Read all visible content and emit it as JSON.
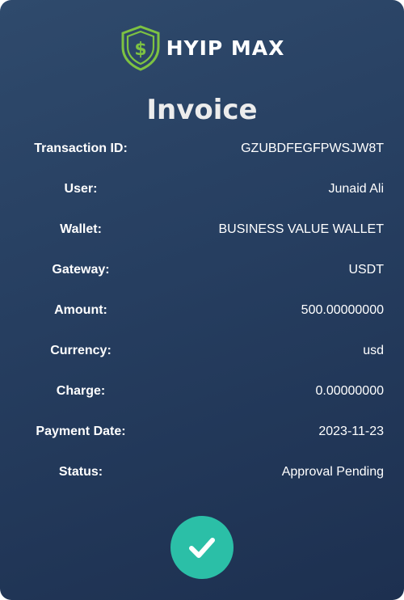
{
  "brand": {
    "name": "HYIP MAX",
    "icon": "shield-dollar-icon",
    "accent_color": "#7dc242"
  },
  "title": "Invoice",
  "invoice": [
    {
      "label": "Transaction ID:",
      "value": "GZUBDFEGFPWSJW8T"
    },
    {
      "label": "User:",
      "value": "Junaid Ali"
    },
    {
      "label": "Wallet:",
      "value": "BUSINESS VALUE WALLET"
    },
    {
      "label": "Gateway:",
      "value": "USDT"
    },
    {
      "label": "Amount:",
      "value": "500.00000000"
    },
    {
      "label": "Currency:",
      "value": "usd"
    },
    {
      "label": "Charge:",
      "value": "0.00000000"
    },
    {
      "label": "Payment Date:",
      "value": "2023-11-23"
    },
    {
      "label": "Status:",
      "value": "Approval Pending"
    }
  ],
  "confirm_button": {
    "icon": "checkmark-icon",
    "color": "#2bbfa7"
  }
}
